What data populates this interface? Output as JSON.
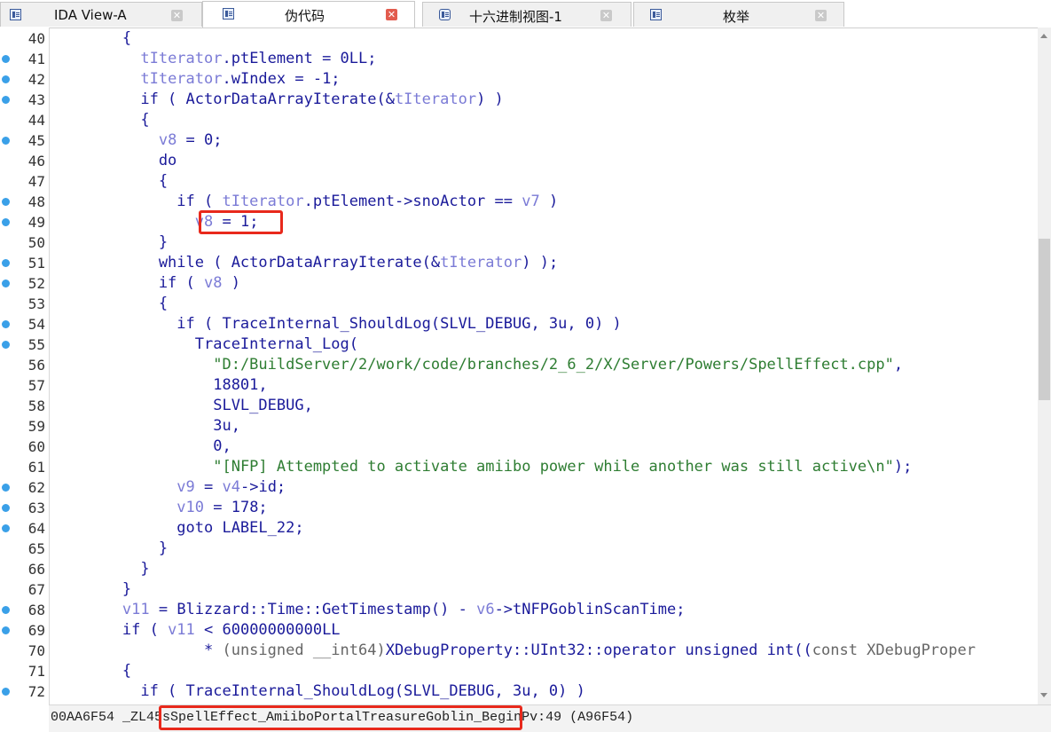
{
  "tabs": [
    {
      "label": "IDA View-A",
      "active": false
    },
    {
      "label": "伪代码",
      "active": true
    },
    {
      "label": "十六进制视图-1",
      "active": false
    },
    {
      "label": "枚举",
      "active": false
    }
  ],
  "code_lines": [
    {
      "num": "40",
      "bp": false,
      "html": "        <span class=\"k\">{</span>"
    },
    {
      "num": "41",
      "bp": true,
      "html": "          <span class=\"v\">tIterator</span>.ptElement = 0LL;"
    },
    {
      "num": "42",
      "bp": true,
      "html": "          <span class=\"v\">tIterator</span>.wIndex = -1;"
    },
    {
      "num": "43",
      "bp": true,
      "html": "          if ( ActorDataArrayIterate(&amp;<span class=\"v\">tIterator</span>) )"
    },
    {
      "num": "44",
      "bp": false,
      "html": "          {"
    },
    {
      "num": "45",
      "bp": true,
      "html": "            <span class=\"v\">v8</span> = 0;"
    },
    {
      "num": "46",
      "bp": false,
      "html": "            do"
    },
    {
      "num": "47",
      "bp": false,
      "html": "            {"
    },
    {
      "num": "48",
      "bp": true,
      "html": "              if ( <span class=\"v\">tIterator</span>.ptElement-&gt;snoActor == <span class=\"v\">v7</span> )"
    },
    {
      "num": "49",
      "bp": true,
      "html": "                <span class=\"v\">v8</span> = 1;"
    },
    {
      "num": "50",
      "bp": false,
      "html": "            }"
    },
    {
      "num": "51",
      "bp": true,
      "html": "            while ( ActorDataArrayIterate(&amp;<span class=\"v\">tIterator</span>) );"
    },
    {
      "num": "52",
      "bp": true,
      "html": "            if ( <span class=\"v\">v8</span> )"
    },
    {
      "num": "53",
      "bp": false,
      "html": "            {"
    },
    {
      "num": "54",
      "bp": true,
      "html": "              if ( TraceInternal_ShouldLog(SLVL_DEBUG, 3u, 0) )"
    },
    {
      "num": "55",
      "bp": true,
      "html": "                TraceInternal_Log("
    },
    {
      "num": "56",
      "bp": false,
      "html": "                  <span class=\"s\">\"D:/BuildServer/2/work/code/branches/2_6_2/X/Server/Powers/SpellEffect.cpp\"</span>,"
    },
    {
      "num": "57",
      "bp": false,
      "html": "                  18801,"
    },
    {
      "num": "58",
      "bp": false,
      "html": "                  SLVL_DEBUG,"
    },
    {
      "num": "59",
      "bp": false,
      "html": "                  3u,"
    },
    {
      "num": "60",
      "bp": false,
      "html": "                  0,"
    },
    {
      "num": "61",
      "bp": false,
      "html": "                  <span class=\"s\">\"[NFP] Attempted to activate amiibo power while another was still active\\n\"</span>);"
    },
    {
      "num": "62",
      "bp": true,
      "html": "              <span class=\"v\">v9</span> = <span class=\"v\">v4</span>-&gt;id;"
    },
    {
      "num": "63",
      "bp": true,
      "html": "              <span class=\"v\">v10</span> = 178;"
    },
    {
      "num": "64",
      "bp": true,
      "html": "              goto LABEL_22;"
    },
    {
      "num": "65",
      "bp": false,
      "html": "            }"
    },
    {
      "num": "66",
      "bp": false,
      "html": "          }"
    },
    {
      "num": "67",
      "bp": false,
      "html": "        }"
    },
    {
      "num": "68",
      "bp": true,
      "html": "        <span class=\"v\">v11</span> = Blizzard::Time::GetTimestamp() - <span class=\"v\">v6</span>-&gt;tNFPGoblinScanTime;"
    },
    {
      "num": "69",
      "bp": true,
      "html": "        if ( <span class=\"v\">v11</span> &lt; 60000000000LL"
    },
    {
      "num": "70",
      "bp": false,
      "html": "                 * <span class=\"d\">(unsigned __int64)</span>XDebugProperty::UInt32::operator unsigned int((<span class=\"d\">const XDebugProper</span>"
    },
    {
      "num": "71",
      "bp": false,
      "html": "        {"
    },
    {
      "num": "72",
      "bp": true,
      "html": "          if ( TraceInternal_ShouldLog(SLVL_DEBUG, 3u, 0) )"
    }
  ],
  "status": {
    "text": "00AA6F54 _ZL45sSpellEffect_AmiiboPortalTreasureGoblin_BeginPv:49 (A96F54)"
  },
  "colors": {
    "breakpoint": "#3aa0e8",
    "highlight_box": "#e8291c",
    "string": "#2e7d32",
    "variable": "#7b7bd6",
    "code": "#1a1a9a"
  }
}
